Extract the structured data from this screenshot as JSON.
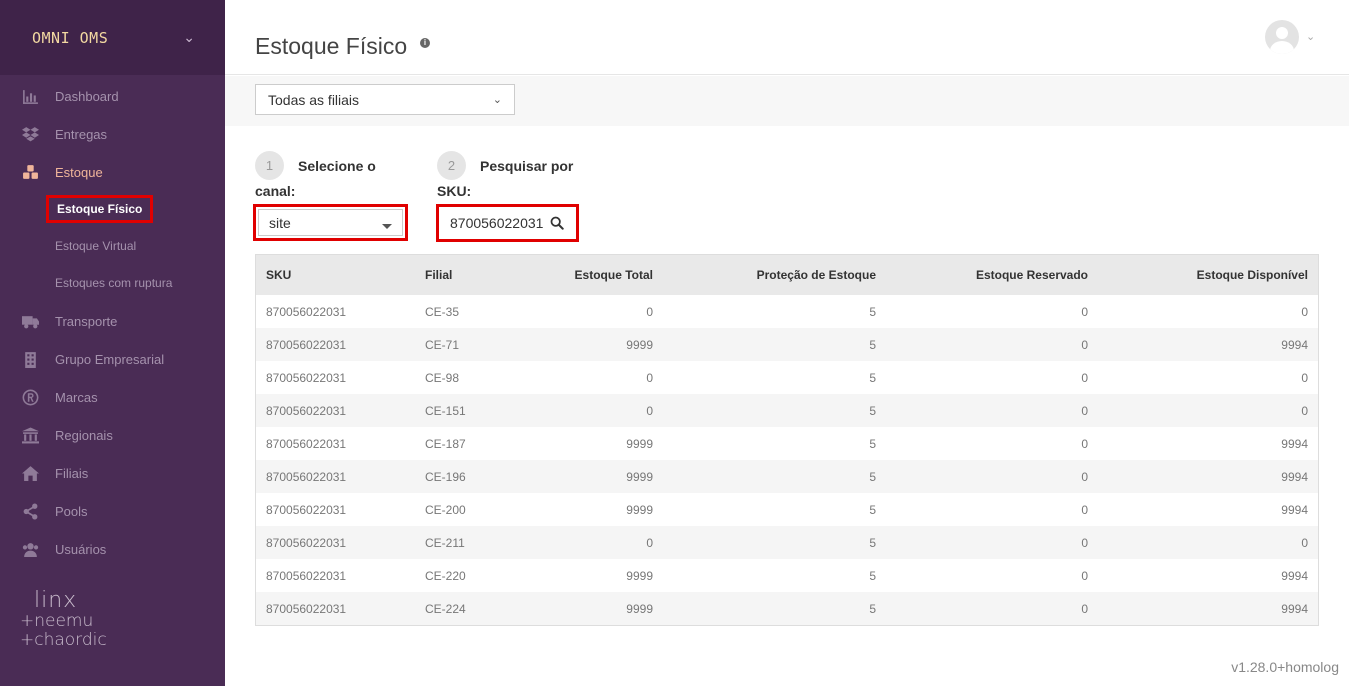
{
  "sidebar": {
    "brand": "OMNI OMS",
    "items": [
      {
        "label": "Dashboard",
        "icon": "bar-chart-icon"
      },
      {
        "label": "Entregas",
        "icon": "dropbox-icon"
      },
      {
        "label": "Estoque",
        "icon": "cubes-icon"
      },
      {
        "label": "Transporte",
        "icon": "truck-icon"
      },
      {
        "label": "Grupo Empresarial",
        "icon": "building-icon"
      },
      {
        "label": "Marcas",
        "icon": "registered-icon"
      },
      {
        "label": "Regionais",
        "icon": "bank-icon"
      },
      {
        "label": "Filiais",
        "icon": "home-icon"
      },
      {
        "label": "Pools",
        "icon": "share-icon"
      },
      {
        "label": "Usuários",
        "icon": "users-icon"
      }
    ],
    "submenu": [
      "Estoque Físico",
      "Estoque Virtual",
      "Estoques com ruptura"
    ],
    "logo": {
      "line1": "linx",
      "line2": "+neemu",
      "line3": "+chaordic"
    }
  },
  "header": {
    "title": "Estoque Físico",
    "info_icon": "info-icon"
  },
  "filters": {
    "branch": "Todas as filiais",
    "step1": {
      "number": "1",
      "text_a": "Selecione o",
      "text_b": "canal:"
    },
    "step2": {
      "number": "2",
      "text_a": "Pesquisar por",
      "text_b": "SKU:"
    },
    "channel": "site",
    "sku_value": "870056022031"
  },
  "table": {
    "columns": [
      "SKU",
      "Filial",
      "Estoque Total",
      "Proteção de Estoque",
      "Estoque Reservado",
      "Estoque Disponível"
    ],
    "rows": [
      [
        "870056022031",
        "CE-35",
        "0",
        "5",
        "0",
        "0"
      ],
      [
        "870056022031",
        "CE-71",
        "9999",
        "5",
        "0",
        "9994"
      ],
      [
        "870056022031",
        "CE-98",
        "0",
        "5",
        "0",
        "0"
      ],
      [
        "870056022031",
        "CE-151",
        "0",
        "5",
        "0",
        "0"
      ],
      [
        "870056022031",
        "CE-187",
        "9999",
        "5",
        "0",
        "9994"
      ],
      [
        "870056022031",
        "CE-196",
        "9999",
        "5",
        "0",
        "9994"
      ],
      [
        "870056022031",
        "CE-200",
        "9999",
        "5",
        "0",
        "9994"
      ],
      [
        "870056022031",
        "CE-211",
        "0",
        "5",
        "0",
        "0"
      ],
      [
        "870056022031",
        "CE-220",
        "9999",
        "5",
        "0",
        "9994"
      ],
      [
        "870056022031",
        "CE-224",
        "9999",
        "5",
        "0",
        "9994"
      ]
    ]
  },
  "footer": {
    "version": "v1.28.0+homolog"
  },
  "colors": {
    "sidebar": "#4a2c55",
    "brand_bg": "#3f2349",
    "active": "#f0b59a",
    "highlight": "#e00000"
  }
}
